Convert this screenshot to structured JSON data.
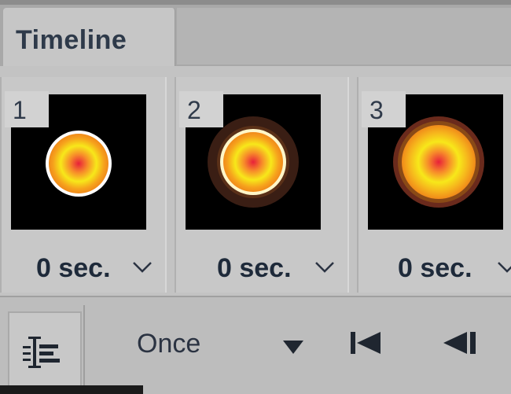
{
  "panel": {
    "tab_title": "Timeline"
  },
  "frames": [
    {
      "number": "1",
      "delay": "0 sec."
    },
    {
      "number": "2",
      "delay": "0 sec."
    },
    {
      "number": "3",
      "delay": "0 sec."
    }
  ],
  "toolbar": {
    "loop_option": "Once"
  },
  "icons": {
    "convert": "convert-to-video-timeline-icon",
    "loop_dropdown": "triangle-down-icon",
    "first_frame": "select-first-frame-icon",
    "previous_frame": "select-previous-frame-icon",
    "frame_delay_menu": "chevron-down-icon"
  },
  "colors": {
    "panel_bg": "#c3c3c3",
    "tab_text": "#2e3a4a",
    "thumb_bg": "#000000"
  }
}
